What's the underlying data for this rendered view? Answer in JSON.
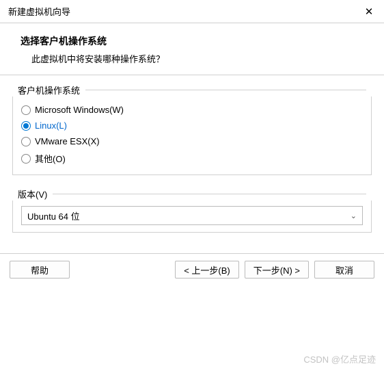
{
  "titlebar": {
    "title": "新建虚拟机向导"
  },
  "header": {
    "title": "选择客户机操作系统",
    "subtitle": "此虚拟机中将安装哪种操作系统？"
  },
  "osGroup": {
    "legend": "客户机操作系统",
    "options": [
      {
        "label": "Microsoft Windows(W)",
        "selected": false
      },
      {
        "label": "Linux(L)",
        "selected": true
      },
      {
        "label": "VMware ESX(X)",
        "selected": false
      },
      {
        "label": "其他(O)",
        "selected": false
      }
    ]
  },
  "version": {
    "label": "版本(V)",
    "selected": "Ubuntu 64 位"
  },
  "footer": {
    "help": "帮助",
    "back": "< 上一步(B)",
    "next": "下一步(N) >",
    "cancel": "取消"
  },
  "watermark": "CSDN @亿点足迹"
}
